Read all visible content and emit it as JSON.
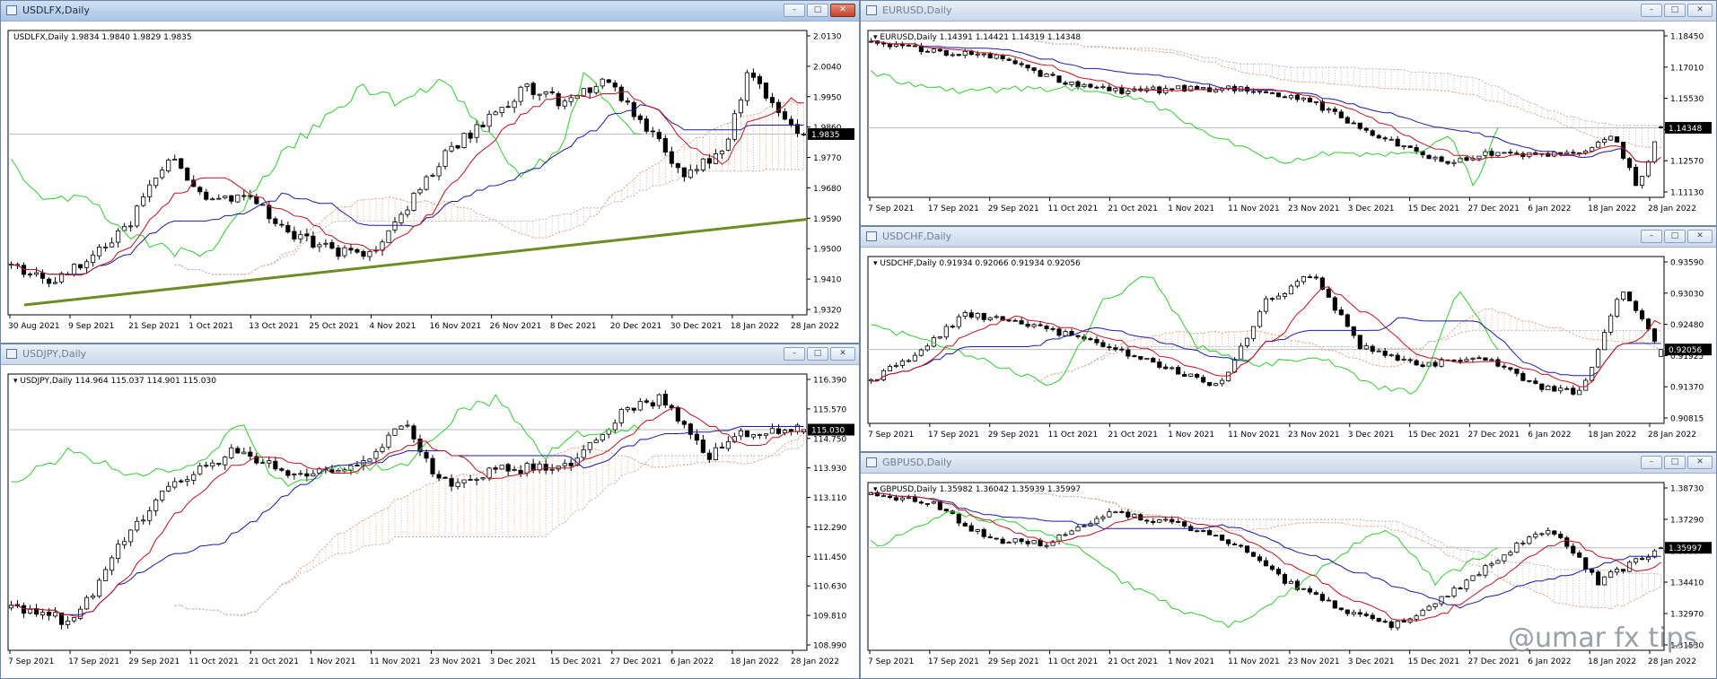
{
  "watermark": "@umar fx tips",
  "charts": [
    {
      "id": "usdlfx",
      "window_title": "USDLFX,Daily",
      "active": true,
      "frame": [
        0,
        0,
        958,
        383
      ],
      "info_label": "USDLFX,Daily  1.9834 1.9840 1.9829 1.9835",
      "current_price": "1.9835",
      "yticks": [
        "2.0130",
        "2.0040",
        "1.9950",
        "1.9860",
        "1.9770",
        "1.9680",
        "1.9590",
        "1.9500",
        "1.9410",
        "1.9320"
      ],
      "xlabels": [
        "30 Aug 2021",
        "9 Sep 2021",
        "21 Sep 2021",
        "1 Oct 2021",
        "13 Oct 2021",
        "25 Oct 2021",
        "4 Nov 2021",
        "16 Nov 2021",
        "26 Nov 2021",
        "8 Dec 2021",
        "20 Dec 2021",
        "30 Dec 2021",
        "18 Jan 2022",
        "28 Jan 2022"
      ],
      "trendline": true
    },
    {
      "id": "eurusd",
      "window_title": "EURUSD,Daily",
      "active": false,
      "frame": [
        958,
        0,
        955,
        252
      ],
      "info_label": "EURUSD,Daily  1.14391 1.14421 1.14319 1.14348",
      "current_price": "1.14348",
      "yticks": [
        "1.18450",
        "1.17010",
        "1.15530",
        "1.14340",
        "1.12570",
        "1.11130"
      ],
      "xlabels": [
        "7 Sep 2021",
        "17 Sep 2021",
        "29 Sep 2021",
        "11 Oct 2021",
        "21 Oct 2021",
        "1 Nov 2021",
        "11 Nov 2021",
        "23 Nov 2021",
        "3 Dec 2021",
        "15 Dec 2021",
        "27 Dec 2021",
        "6 Jan 2022",
        "18 Jan 2022",
        "28 Jan 2022"
      ],
      "trendline": false
    },
    {
      "id": "usdchf",
      "window_title": "USDCHF,Daily",
      "active": false,
      "frame": [
        958,
        252,
        955,
        252
      ],
      "info_label": "USDCHF,Daily  0.91934 0.92066 0.91934 0.92056",
      "current_price": "0.92056",
      "yticks": [
        "0.93590",
        "0.93030",
        "0.92480",
        "0.91925",
        "0.91370",
        "0.90815"
      ],
      "xlabels": [
        "7 Sep 2021",
        "17 Sep 2021",
        "29 Sep 2021",
        "11 Oct 2021",
        "21 Oct 2021",
        "1 Nov 2021",
        "11 Nov 2021",
        "23 Nov 2021",
        "3 Dec 2021",
        "15 Dec 2021",
        "27 Dec 2021",
        "6 Jan 2022",
        "18 Jan 2022",
        "28 Jan 2022"
      ],
      "trendline": false
    },
    {
      "id": "usdjpy",
      "window_title": "USDJPY,Daily",
      "active": false,
      "frame": [
        0,
        383,
        958,
        374
      ],
      "info_label": "USDJPY,Daily  114.964 115.037 114.901 115.030",
      "current_price": "115.030",
      "yticks": [
        "116.390",
        "115.570",
        "114.750",
        "113.930",
        "113.110",
        "112.290",
        "111.450",
        "110.630",
        "109.810",
        "108.990"
      ],
      "xlabels": [
        "7 Sep 2021",
        "17 Sep 2021",
        "29 Sep 2021",
        "11 Oct 2021",
        "21 Oct 2021",
        "1 Nov 2021",
        "11 Nov 2021",
        "23 Nov 2021",
        "3 Dec 2021",
        "15 Dec 2021",
        "27 Dec 2021",
        "6 Jan 2022",
        "18 Jan 2022",
        "28 Jan 2022"
      ],
      "trendline": false
    },
    {
      "id": "gbpusd",
      "window_title": "GBPUSD,Daily",
      "active": false,
      "frame": [
        958,
        504,
        955,
        253
      ],
      "info_label": "GBPUSD,Daily  1.35982 1.36042 1.35939 1.35997",
      "current_price": "1.35997",
      "yticks": [
        "1.38730",
        "1.37290",
        "1.35997",
        "1.34410",
        "1.32970",
        "1.31530"
      ],
      "xlabels": [
        "7 Sep 2021",
        "17 Sep 2021",
        "29 Sep 2021",
        "11 Oct 2021",
        "21 Oct 2021",
        "1 Nov 2021",
        "11 Nov 2021",
        "23 Nov 2021",
        "3 Dec 2021",
        "15 Dec 2021",
        "27 Dec 2021",
        "6 Jan 2022",
        "18 Jan 2022",
        "28 Jan 2022"
      ],
      "trendline": false
    }
  ],
  "chart_data": [
    {
      "type": "candlestick",
      "symbol": "USDLFX",
      "timeframe": "Daily",
      "last_bar": {
        "open": 1.9834,
        "high": 1.984,
        "low": 1.9829,
        "close": 1.9835
      },
      "ylim": [
        1.932,
        2.013
      ],
      "close_path": [
        [
          0,
          1.946
        ],
        [
          0.05,
          1.941
        ],
        [
          0.1,
          1.949
        ],
        [
          0.15,
          1.958
        ],
        [
          0.2,
          1.978
        ],
        [
          0.25,
          1.964
        ],
        [
          0.3,
          1.967
        ],
        [
          0.35,
          1.955
        ],
        [
          0.4,
          1.951
        ],
        [
          0.45,
          1.948
        ],
        [
          0.5,
          1.963
        ],
        [
          0.55,
          1.978
        ],
        [
          0.6,
          1.988
        ],
        [
          0.65,
          1.997
        ],
        [
          0.7,
          1.992
        ],
        [
          0.75,
          1.999
        ],
        [
          0.8,
          1.986
        ],
        [
          0.85,
          1.972
        ],
        [
          0.9,
          1.979
        ],
        [
          0.93,
          2.001
        ],
        [
          0.97,
          1.989
        ],
        [
          1.0,
          1.9835
        ]
      ],
      "ichimoku": true,
      "trendline": [
        [
          0.02,
          1.9348
        ],
        [
          1.0,
          1.9592
        ]
      ]
    },
    {
      "type": "candlestick",
      "symbol": "EURUSD",
      "timeframe": "Daily",
      "last_bar": {
        "open": 1.14391,
        "high": 1.14421,
        "low": 1.14319,
        "close": 1.14348
      },
      "ylim": [
        1.1113,
        1.1885
      ],
      "close_path": [
        [
          0,
          1.183
        ],
        [
          0.08,
          1.179
        ],
        [
          0.16,
          1.176
        ],
        [
          0.24,
          1.165
        ],
        [
          0.32,
          1.16
        ],
        [
          0.4,
          1.162
        ],
        [
          0.48,
          1.161
        ],
        [
          0.56,
          1.155
        ],
        [
          0.64,
          1.14
        ],
        [
          0.72,
          1.128
        ],
        [
          0.78,
          1.131
        ],
        [
          0.84,
          1.1305
        ],
        [
          0.9,
          1.133
        ],
        [
          0.94,
          1.141
        ],
        [
          0.97,
          1.1165
        ],
        [
          1.0,
          1.14348
        ]
      ],
      "ichimoku": true
    },
    {
      "type": "candlestick",
      "symbol": "USDCHF",
      "timeframe": "Daily",
      "last_bar": {
        "open": 0.91934,
        "high": 0.92066,
        "low": 0.91934,
        "close": 0.92056
      },
      "ylim": [
        0.9075,
        0.937
      ],
      "close_path": [
        [
          0,
          0.915
        ],
        [
          0.06,
          0.92
        ],
        [
          0.12,
          0.927
        ],
        [
          0.2,
          0.925
        ],
        [
          0.28,
          0.922
        ],
        [
          0.36,
          0.918
        ],
        [
          0.44,
          0.914
        ],
        [
          0.5,
          0.929
        ],
        [
          0.56,
          0.934
        ],
        [
          0.62,
          0.921
        ],
        [
          0.7,
          0.918
        ],
        [
          0.78,
          0.919
        ],
        [
          0.84,
          0.914
        ],
        [
          0.9,
          0.913
        ],
        [
          0.95,
          0.931
        ],
        [
          1.0,
          0.92056
        ]
      ],
      "ichimoku": true
    },
    {
      "type": "candlestick",
      "symbol": "USDJPY",
      "timeframe": "Daily",
      "last_bar": {
        "open": 114.964,
        "high": 115.037,
        "low": 114.901,
        "close": 115.03
      },
      "ylim": [
        108.8,
        116.6
      ],
      "close_path": [
        [
          0,
          110.0
        ],
        [
          0.08,
          109.6
        ],
        [
          0.14,
          111.9
        ],
        [
          0.2,
          113.4
        ],
        [
          0.28,
          114.4
        ],
        [
          0.36,
          113.8
        ],
        [
          0.44,
          114.1
        ],
        [
          0.5,
          115.2
        ],
        [
          0.54,
          113.5
        ],
        [
          0.62,
          113.9
        ],
        [
          0.7,
          114.0
        ],
        [
          0.78,
          115.7
        ],
        [
          0.82,
          115.9
        ],
        [
          0.88,
          114.3
        ],
        [
          0.92,
          114.9
        ],
        [
          1.0,
          115.03
        ]
      ],
      "ichimoku": true
    },
    {
      "type": "candlestick",
      "symbol": "GBPUSD",
      "timeframe": "Daily",
      "last_bar": {
        "open": 1.35982,
        "high": 1.36042,
        "low": 1.35939,
        "close": 1.35997
      },
      "ylim": [
        1.312,
        1.3905
      ],
      "close_path": [
        [
          0,
          1.385
        ],
        [
          0.08,
          1.38
        ],
        [
          0.15,
          1.364
        ],
        [
          0.22,
          1.362
        ],
        [
          0.3,
          1.376
        ],
        [
          0.38,
          1.372
        ],
        [
          0.46,
          1.362
        ],
        [
          0.52,
          1.345
        ],
        [
          0.6,
          1.33
        ],
        [
          0.66,
          1.324
        ],
        [
          0.72,
          1.335
        ],
        [
          0.8,
          1.357
        ],
        [
          0.86,
          1.37
        ],
        [
          0.92,
          1.344
        ],
        [
          1.0,
          1.35997
        ]
      ],
      "ichimoku": true
    }
  ]
}
